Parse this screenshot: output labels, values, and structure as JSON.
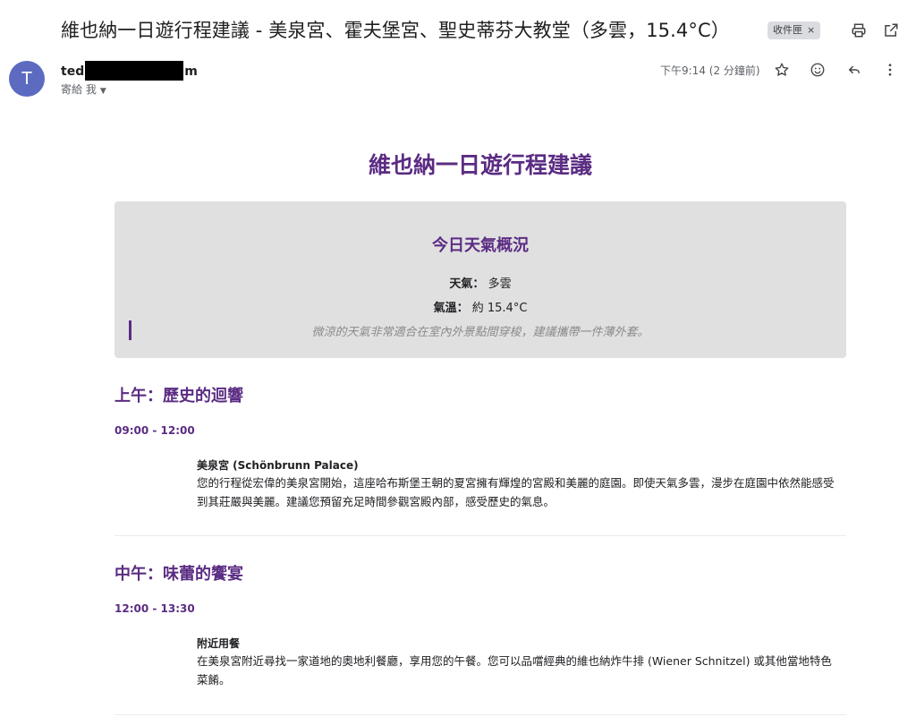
{
  "email": {
    "subject": "維也納一日遊行程建議 - 美泉宮、霍夫堡宮、聖史蒂芬大教堂（多雲，15.4°C）",
    "label": "收件匣",
    "label_close": "×",
    "sender_initial": "T",
    "sender_prefix": "ted",
    "sender_suffix": "m",
    "recipient": "寄給 我",
    "timestamp": "下午9:14 (2 分鐘前)"
  },
  "icons": {
    "print": "print-icon",
    "open_new": "open-in-new-icon",
    "star": "star-icon",
    "emoji": "emoji-icon",
    "reply": "reply-icon",
    "more": "more-vert-icon",
    "caret": "caret-down-icon"
  },
  "body": {
    "title": "維也納一日遊行程建議",
    "weather": {
      "heading": "今日天氣概況",
      "condition_label": "天氣：",
      "condition_value": "多雲",
      "temp_label": "氣溫：",
      "temp_value": "約 15.4°C",
      "note": "微涼的天氣非常適合在室內外景點間穿梭，建議攜帶一件薄外套。"
    },
    "sections": [
      {
        "title": "上午：歷史的迴響",
        "time": "09:00 - 12:00",
        "place": "美泉宮 (Schönbrunn Palace)",
        "description": "您的行程從宏偉的美泉宮開始，這座哈布斯堡王朝的夏宮擁有輝煌的宮殿和美麗的庭園。即使天氣多雲，漫步在庭園中依然能感受到其莊嚴與美麗。建議您預留充足時間參觀宮殿內部，感受歷史的氣息。"
      },
      {
        "title": "中午：味蕾的饗宴",
        "time": "12:00 - 13:30",
        "place": "附近用餐",
        "description": "在美泉宮附近尋找一家道地的奧地利餐廳，享用您的午餐。您可以品嚐經典的維也納炸牛排 (Wiener Schnitzel) 或其他當地特色菜餚。"
      }
    ]
  },
  "colors": {
    "accent": "#5b2c83",
    "avatar": "#5c6bc0",
    "weather_bg": "#e0e0e0"
  }
}
